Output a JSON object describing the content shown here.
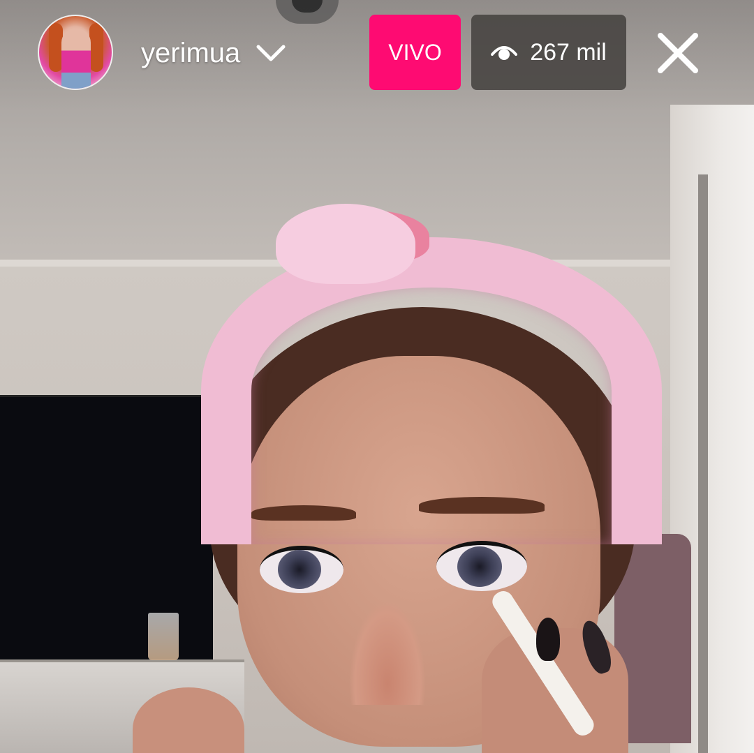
{
  "stream": {
    "username": "yerimua",
    "live_label": "VIVO",
    "viewer_count": "267 mil"
  },
  "icons": {
    "chevron": "chevron-down-icon",
    "viewers": "eye-icon",
    "close": "close-icon"
  },
  "colors": {
    "live_badge": "#fe0b72",
    "viewer_pill": "#464240",
    "text": "#ffffff"
  }
}
